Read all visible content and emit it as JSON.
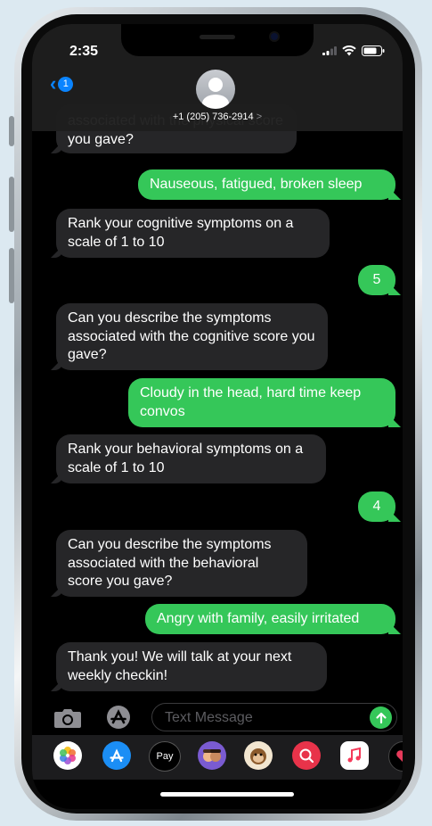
{
  "status_bar": {
    "time": "2:35"
  },
  "nav": {
    "back_badge": "1",
    "contact_number": "+1 (205) 736-2914",
    "contact_chevron": ">"
  },
  "messages": [
    {
      "from": "them",
      "text": "associated with the physical score you gave?"
    },
    {
      "from": "me",
      "text": "Nauseous, fatigued, broken sleep"
    },
    {
      "from": "them",
      "text": "Rank your cognitive symptoms on a scale of 1 to 10"
    },
    {
      "from": "me",
      "text": "5"
    },
    {
      "from": "them",
      "text": "Can you describe the symptoms associated with the cognitive score you gave?"
    },
    {
      "from": "me",
      "text": "Cloudy in the head, hard time keep convos"
    },
    {
      "from": "them",
      "text": "Rank your behavioral symptoms on a scale of 1 to 10"
    },
    {
      "from": "me",
      "text": "4"
    },
    {
      "from": "them",
      "text": "Can you describe the symptoms associated with the behavioral score you gave?"
    },
    {
      "from": "me",
      "text": "Angry with family, easily irritated"
    },
    {
      "from": "them",
      "text": "Thank you! We will talk at your next weekly checkin!"
    }
  ],
  "input": {
    "placeholder": "Text Message"
  },
  "apps": [
    {
      "name": "photos-app-icon"
    },
    {
      "name": "app-store-app-icon"
    },
    {
      "name": "apple-pay-app-icon",
      "label": "Pay"
    },
    {
      "name": "memoji-app-icon"
    },
    {
      "name": "animoji-app-icon"
    },
    {
      "name": "image-search-app-icon"
    },
    {
      "name": "music-app-icon"
    },
    {
      "name": "digital-touch-app-icon"
    }
  ],
  "colors": {
    "accent_blue": "#0a84ff",
    "sent_green": "#35c759",
    "received_gray": "#262628"
  }
}
